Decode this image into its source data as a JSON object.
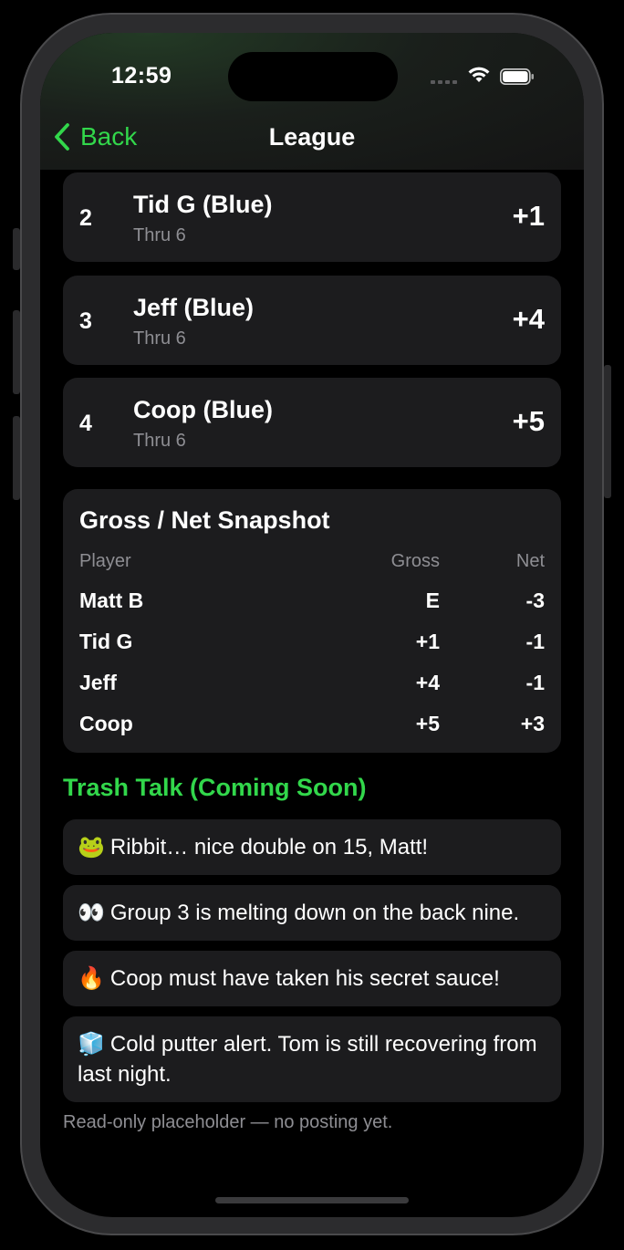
{
  "status": {
    "time": "12:59"
  },
  "nav": {
    "back_label": "Back",
    "title": "League"
  },
  "leaderboard": [
    {
      "rank": "2",
      "name": "Tid G (Blue)",
      "thru": "Thru 6",
      "score": "+1"
    },
    {
      "rank": "3",
      "name": "Jeff (Blue)",
      "thru": "Thru 6",
      "score": "+4"
    },
    {
      "rank": "4",
      "name": "Coop (Blue)",
      "thru": "Thru 6",
      "score": "+5"
    }
  ],
  "snapshot": {
    "title": "Gross / Net Snapshot",
    "headers": {
      "player": "Player",
      "gross": "Gross",
      "net": "Net"
    },
    "rows": [
      {
        "player": "Matt B",
        "gross": "E",
        "net": "-3"
      },
      {
        "player": "Tid G",
        "gross": "+1",
        "net": "-1"
      },
      {
        "player": "Jeff",
        "gross": "+4",
        "net": "-1"
      },
      {
        "player": "Coop",
        "gross": "+5",
        "net": "+3"
      }
    ]
  },
  "trash_talk": {
    "header": "Trash Talk (Coming Soon)",
    "messages": [
      {
        "emoji": "🐸",
        "text": "Ribbit… nice double on 15, Matt!"
      },
      {
        "emoji": "👀",
        "text": "Group 3 is melting down on the back nine."
      },
      {
        "emoji": "🔥",
        "text": "Coop must have taken his secret sauce!"
      },
      {
        "emoji": "🧊",
        "text": "Cold putter alert. Tom is still recovering from last night."
      }
    ],
    "footer": "Read-only placeholder — no posting yet."
  },
  "colors": {
    "accent": "#32d74b",
    "card": "#1c1c1e",
    "secondary_text": "#8e8e93"
  }
}
